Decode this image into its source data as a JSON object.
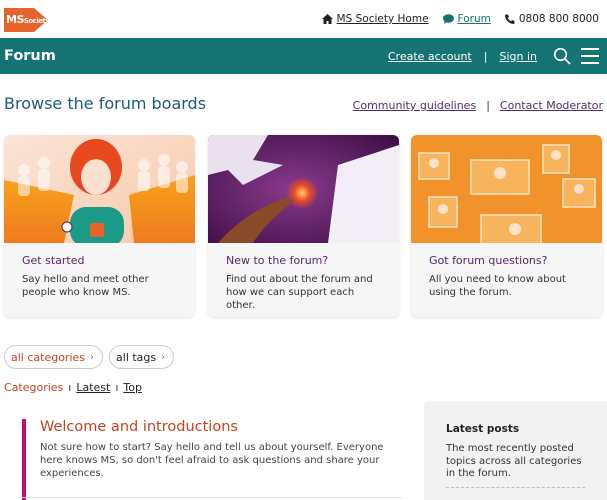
{
  "header": {
    "logo_text": "MS",
    "logo_small": "Society",
    "links": [
      {
        "label": "MS Society Home",
        "icon": "home-icon"
      },
      {
        "label": "Forum",
        "icon": "chat-icon"
      },
      {
        "label": "0808 800 8000",
        "icon": "phone-icon"
      }
    ]
  },
  "nav": {
    "title": "Forum",
    "create_account": "Create account",
    "separator": "|",
    "sign_in": "Sign in"
  },
  "browse": {
    "title": "Browse the forum boards",
    "community_guidelines": "Community guidelines",
    "separator": "|",
    "contact_moderator": "Contact Moderator"
  },
  "cards": [
    {
      "title": "Get started",
      "desc": "Say hello and meet other people who know MS."
    },
    {
      "title": "New to the forum?",
      "desc": "Find out about the forum and how we can support each other."
    },
    {
      "title": "Got forum questions?",
      "desc": "All you need to know about using the forum."
    }
  ],
  "filters": {
    "categories": "all categories",
    "tags": "all tags"
  },
  "tabs": {
    "categories": "Categories",
    "latest": "Latest",
    "top": "Top"
  },
  "welcome": {
    "title": "Welcome and introductions",
    "desc": "Not sure how to start? Say hello and tell us about yourself. Everyone here knows MS, so don't feel afraid to ask questions and share your experiences."
  },
  "latest": {
    "title": "Latest posts",
    "desc": "The most recently posted topics across all categories in the forum."
  },
  "colors": {
    "teal": "#167373",
    "orange": "#e8622c",
    "purple": "#5a1f6b",
    "magenta": "#c40f6b"
  }
}
